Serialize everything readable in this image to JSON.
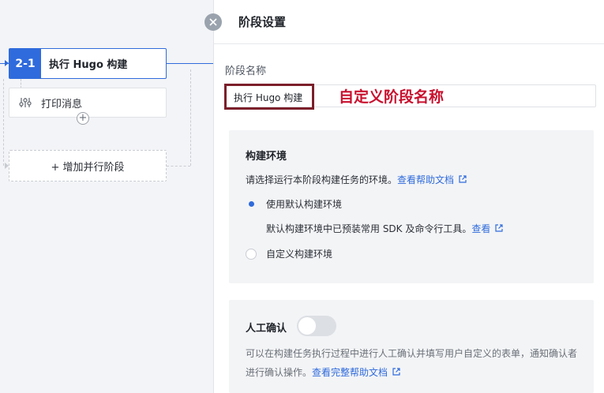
{
  "canvas": {
    "stage": {
      "number": "2-1",
      "title": "执行 Hugo 构建"
    },
    "task": {
      "label": "打印消息",
      "icon": "sliders-icon"
    },
    "add_parallel_label": "+ 增加并行阶段"
  },
  "panel": {
    "title": "阶段设置",
    "name_field": {
      "label": "阶段名称",
      "value": "执行 Hugo 构建"
    },
    "annotation": "自定义阶段名称",
    "build_env": {
      "title": "构建环境",
      "description": "请选择运行本阶段构建任务的环境。",
      "help_link": "查看帮助文档",
      "options": [
        {
          "label": "使用默认构建环境",
          "selected": true
        },
        {
          "label": "自定义构建环境",
          "selected": false
        }
      ],
      "default_note": "默认构建环境中已预装常用 SDK 及命令行工具。",
      "default_note_link": "查看"
    },
    "manual_confirm": {
      "title": "人工确认",
      "enabled": false,
      "description": "可以在构建任务执行过程中进行人工确认并填写用户自定义的表单，通知确认者进行确认操作。",
      "help_link": "查看完整帮助文档"
    }
  },
  "colors": {
    "accent": "#2f6bdc",
    "annotation": "#c8102e",
    "highlight_border": "#7b1f2a"
  }
}
